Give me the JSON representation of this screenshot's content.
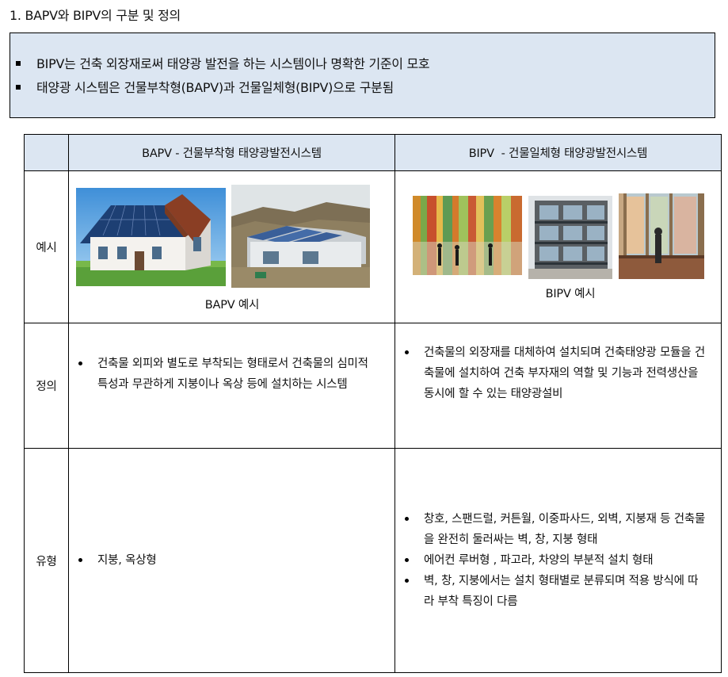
{
  "heading": "1. BAPV와 BIPV의 구분 및 정의",
  "summary": [
    "BIPV는 건축 외장재로써 태양광 발전을 하는 시스템이나 명확한 기준이 모호",
    "태양광 시스템은 건물부착형(BAPV)과 건물일체형(BIPV)으로 구분됨"
  ],
  "table": {
    "headers": [
      "",
      "BAPV - 건물부착형 태양광발전시스템",
      "BIPV  - 건물일체형 태양광발전시스템"
    ],
    "rows": {
      "example": {
        "label": "예시",
        "bapv_caption": "BAPV 예시",
        "bipv_caption": "BIPV 예시"
      },
      "definition": {
        "label": "정의",
        "bapv": [
          "건축물 외피와 별도로 부착되는 형태로서 건축물의 심미적 특성과 무관하게 지붕이나 옥상 등에 설치하는 시스템"
        ],
        "bipv": [
          "건축물의 외장재를 대체하여 설치되며 건축태양광 모듈을 건축물에 설치하여 건축 부자재의 역할 및 기능과 전력생산을 동시에 할 수 있는 태양광설비"
        ]
      },
      "type": {
        "label": "유형",
        "bapv": [
          "지붕, 옥상형"
        ],
        "bipv": [
          "창호, 스팬드럴, 커튼월, 이중파사드, 외벽, 지붕재 등 건축물을 완전히 둘러싸는 벽, 창, 지붕 형태",
          "에어컨 루버형 , 파고라, 차양의 부분적 설치 형태",
          "벽, 창, 지붕에서는 설치 형태별로 분류되며 적용 방식에 따라 부착 특징이 다름"
        ]
      }
    }
  },
  "images": {
    "bapv": [
      "house-solar-roof-photo",
      "factory-solar-roof-photo"
    ],
    "bipv": [
      "color-glass-facade-photo",
      "apartment-pv-facade-photo",
      "interior-pv-window-photo"
    ]
  }
}
